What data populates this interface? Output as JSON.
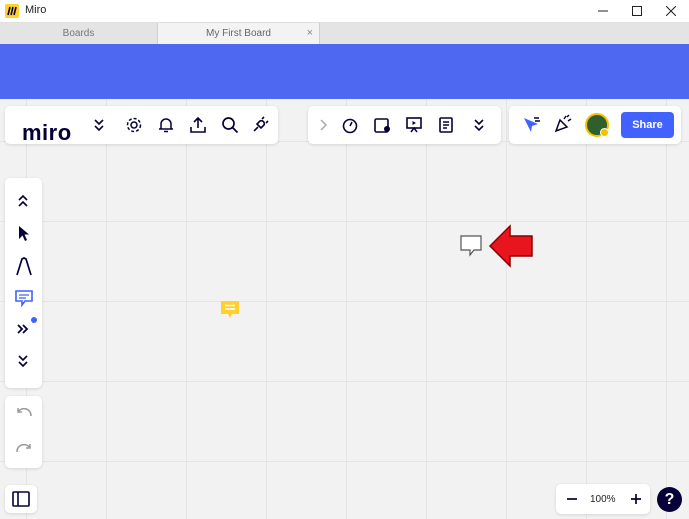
{
  "window": {
    "title": "Miro"
  },
  "tabs": [
    {
      "label": "Boards"
    },
    {
      "label": "My First Board",
      "close": "×"
    }
  ],
  "toolbar": {
    "logo": "miro",
    "share_label": "Share"
  },
  "zoom": {
    "level": "100%",
    "help": "?"
  },
  "colors": {
    "accent": "#4262ff",
    "banner": "#4f68f2",
    "sticky": "#ffd02f",
    "arrow": "#e8141e"
  },
  "icons": {
    "top_left": [
      "chevron-double-down-icon",
      "settings-icon",
      "bell-icon",
      "upload-icon",
      "search-icon",
      "plug-icon"
    ],
    "top_center": [
      "chevron-right-icon",
      "timer-icon",
      "card-icon",
      "presentation-icon",
      "notes-icon",
      "chevron-double-down-icon"
    ],
    "top_right": [
      "cursor-reactions-icon",
      "party-icon",
      "avatar"
    ],
    "left": [
      "chevron-double-up-icon",
      "select-icon",
      "pen-icon",
      "comment-icon",
      "more-tools-icon",
      "chevron-double-down-icon",
      "undo-icon",
      "redo-icon"
    ]
  }
}
